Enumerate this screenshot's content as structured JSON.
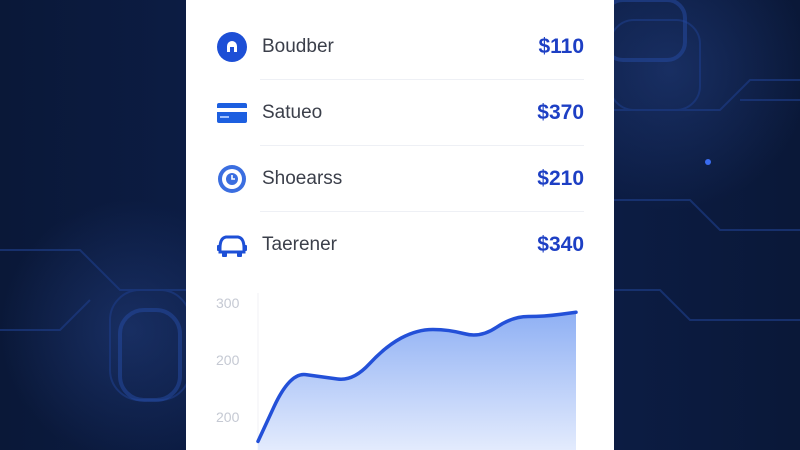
{
  "theme": {
    "accent": "#1d3fc4",
    "line": "#2350d8",
    "fill_top": "#8fb0f4",
    "fill_bottom": "#dfe8fd",
    "background": "#0b1a3e"
  },
  "rows": [
    {
      "icon": "home-icon",
      "label": "Boudber",
      "amount": "$110"
    },
    {
      "icon": "card-icon",
      "label": "Satueo",
      "amount": "$370"
    },
    {
      "icon": "clock-icon",
      "label": "Shoearss",
      "amount": "$210"
    },
    {
      "icon": "car-icon",
      "label": "Taerener",
      "amount": "$340"
    }
  ],
  "chart_data": {
    "type": "area",
    "title": "",
    "xlabel": "",
    "ylabel": "",
    "y_ticks": [
      "300",
      "200",
      "200"
    ],
    "ylim": [
      150,
      330
    ],
    "grid": false,
    "series": [
      {
        "values": [
          160,
          240,
          235,
          230,
          270,
          290,
          290,
          280,
          305,
          305,
          310
        ]
      }
    ]
  }
}
